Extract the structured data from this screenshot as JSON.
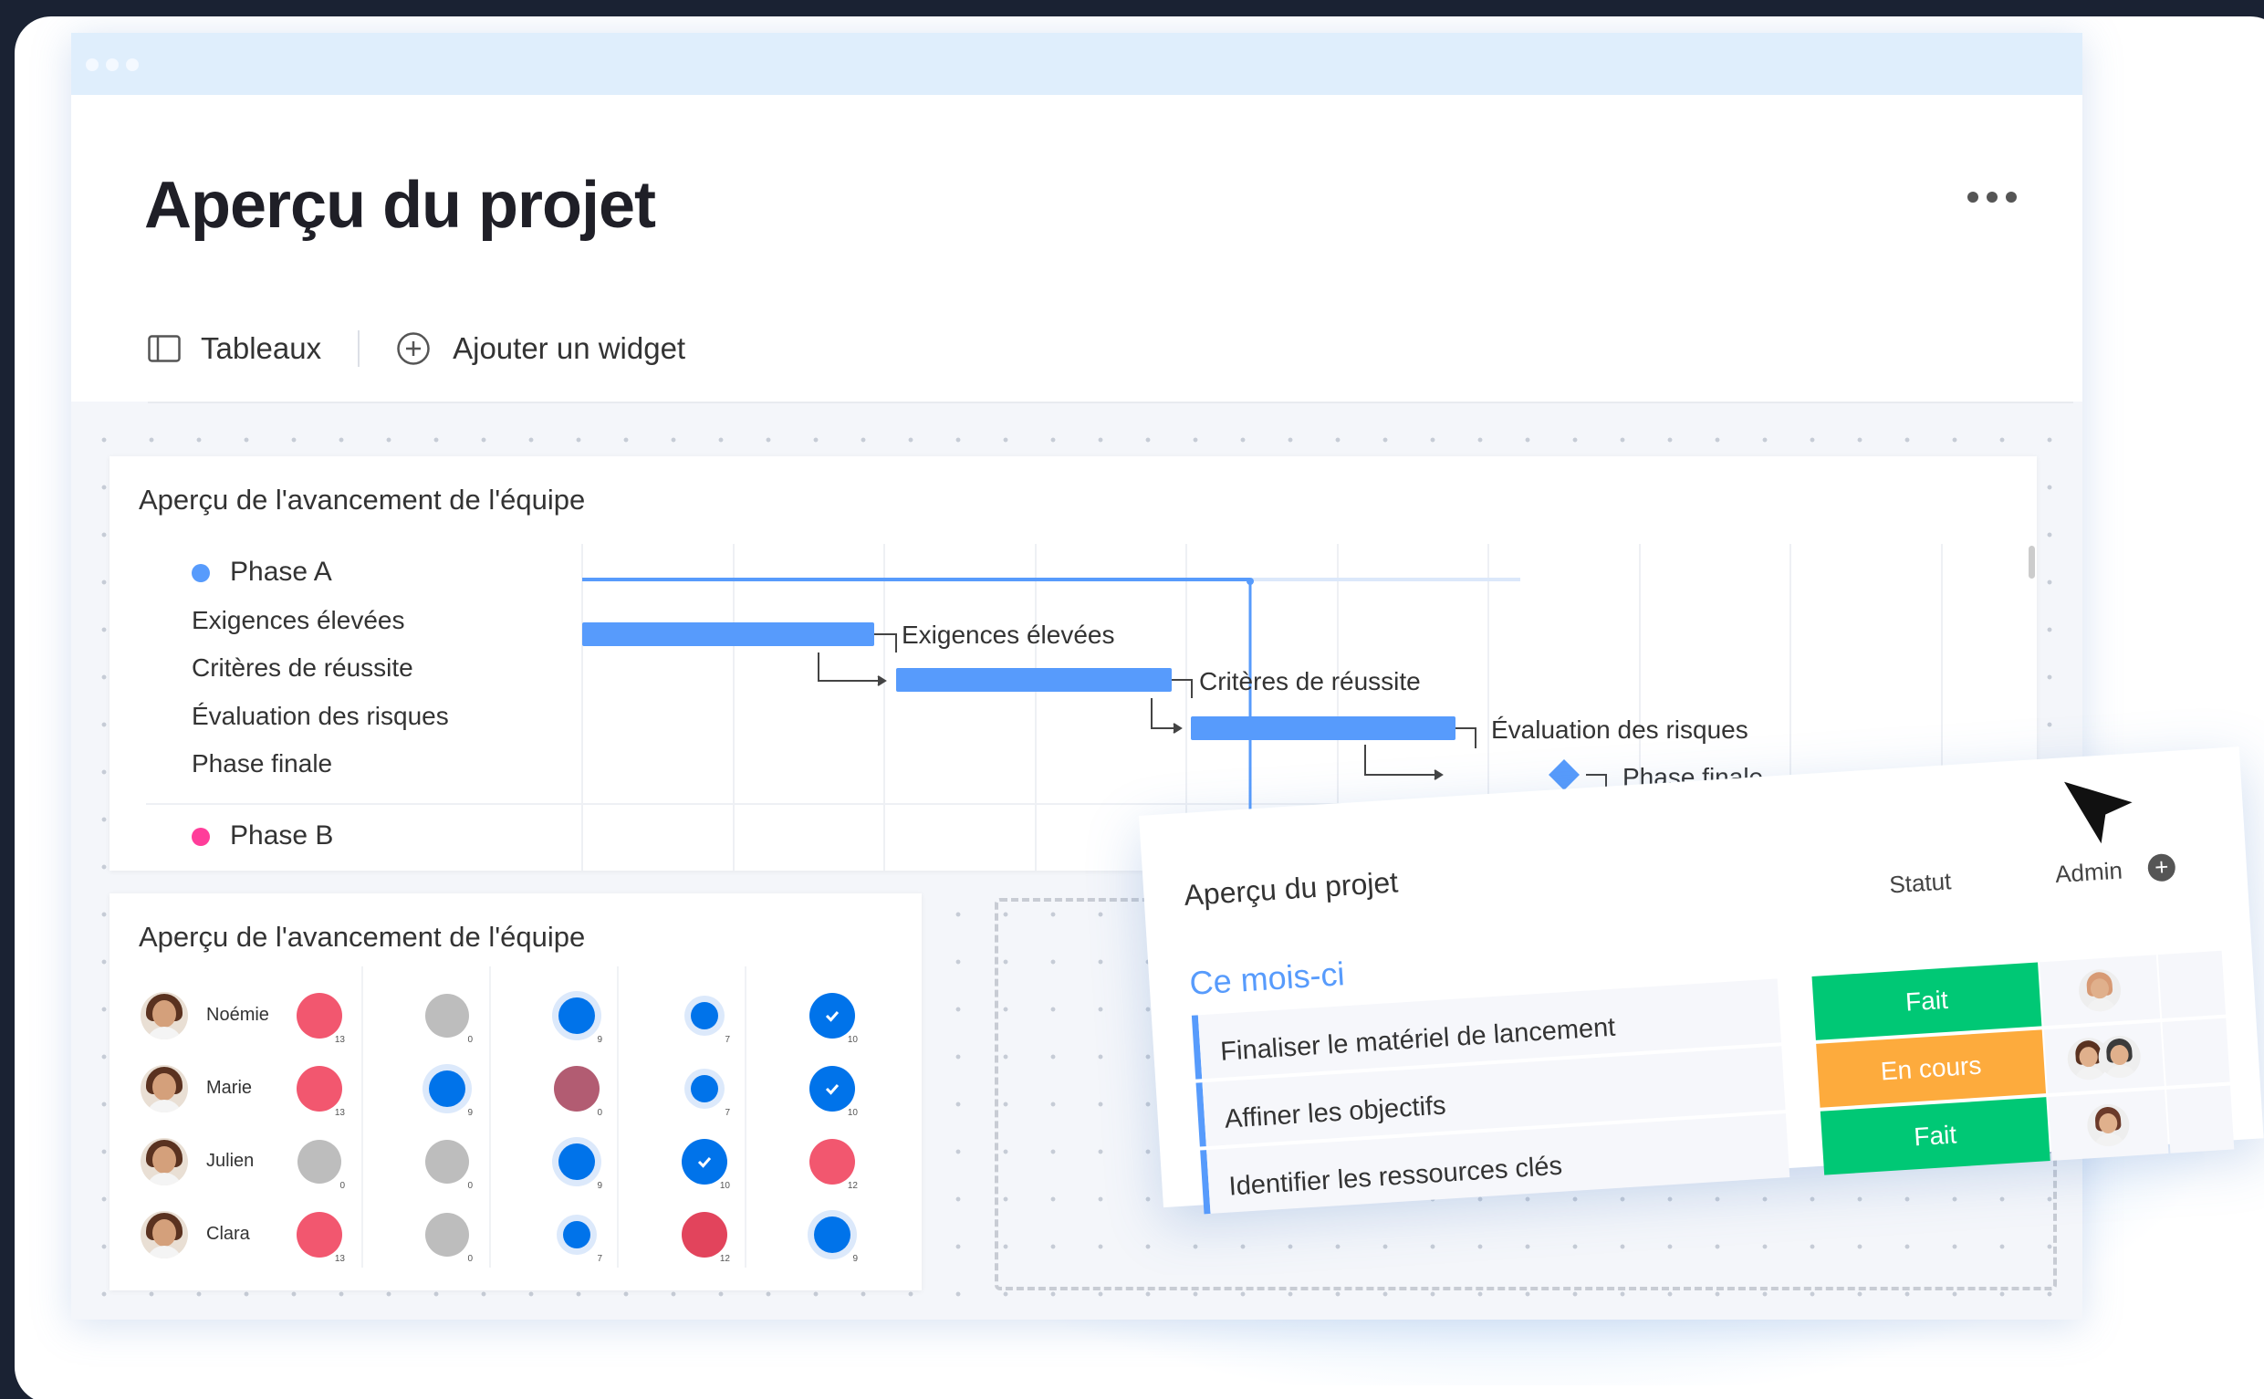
{
  "window": {
    "title": "Aperçu du projet"
  },
  "toolbar": {
    "boards_label": "Tableaux",
    "add_widget_label": "Ajouter un widget"
  },
  "gantt": {
    "title": "Aperçu de l'avancement de l'équipe",
    "phase_a": {
      "name": "Phase A",
      "color": "#579bfc"
    },
    "phase_b": {
      "name": "Phase B",
      "color": "#ff3d9a"
    },
    "tasks": [
      "Exigences élevées",
      "Critères de réussite",
      "Évaluation des risques",
      "Phase finale"
    ],
    "bar_color": "#579bfc"
  },
  "progress": {
    "title": "Aperçu de l'avancement de l'équipe",
    "people": [
      {
        "name": "Noémie",
        "cells": [
          {
            "kind": "red",
            "count": "13"
          },
          {
            "kind": "gray",
            "count": "0"
          },
          {
            "kind": "blue",
            "count": "9"
          },
          {
            "kind": "blue-ring",
            "count": "7"
          },
          {
            "kind": "check",
            "count": "10"
          }
        ]
      },
      {
        "name": "Marie",
        "cells": [
          {
            "kind": "red",
            "count": "13"
          },
          {
            "kind": "blue",
            "count": "9"
          },
          {
            "kind": "mauve",
            "count": "0"
          },
          {
            "kind": "blue-ring",
            "count": "7"
          },
          {
            "kind": "check",
            "count": "10"
          }
        ]
      },
      {
        "name": "Julien",
        "cells": [
          {
            "kind": "gray",
            "count": "0"
          },
          {
            "kind": "gray",
            "count": "0"
          },
          {
            "kind": "blue",
            "count": "9"
          },
          {
            "kind": "check",
            "count": "10"
          },
          {
            "kind": "red",
            "count": "12"
          }
        ]
      },
      {
        "name": "Clara",
        "cells": [
          {
            "kind": "red",
            "count": "13"
          },
          {
            "kind": "gray",
            "count": "0"
          },
          {
            "kind": "blue-ring",
            "count": "7"
          },
          {
            "kind": "red-dark",
            "count": "12"
          },
          {
            "kind": "blue",
            "count": "9"
          }
        ]
      }
    ]
  },
  "project_card": {
    "title": "Aperçu du projet",
    "group": "Ce mois-ci",
    "columns": {
      "status": "Statut",
      "admin": "Admin"
    },
    "rows": [
      {
        "task": "Finaliser le matériel de lancement",
        "status": "Fait",
        "status_color": "#00c875"
      },
      {
        "task": "Affiner les objectifs",
        "status": "En cours",
        "status_color": "#fdab3d"
      },
      {
        "task": "Identifier les ressources clés",
        "status": "Fait",
        "status_color": "#00c875"
      }
    ]
  },
  "colors": {
    "accent": "#579bfc",
    "status_done": "#00c875",
    "status_working": "#fdab3d",
    "title_bar": "#dfeefc"
  }
}
